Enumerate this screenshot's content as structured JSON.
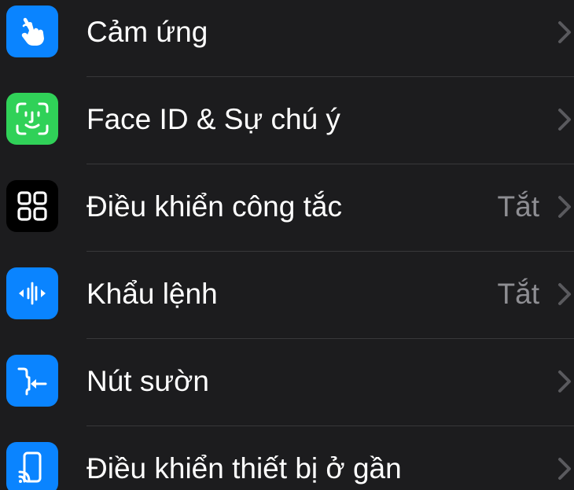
{
  "settings": {
    "rows": [
      {
        "label": "Cảm ứng",
        "value": "",
        "icon": "touch-hand-icon",
        "icon_bg": "#0a84ff"
      },
      {
        "label": "Face ID & Sự chú ý",
        "value": "",
        "icon": "face-id-icon",
        "icon_bg": "#30d158"
      },
      {
        "label": "Điều khiển công tắc",
        "value": "Tắt",
        "icon": "switch-control-grid-icon",
        "icon_bg": "#000000"
      },
      {
        "label": "Khẩu lệnh",
        "value": "Tắt",
        "icon": "voice-control-waveform-icon",
        "icon_bg": "#0a84ff"
      },
      {
        "label": "Nút sườn",
        "value": "",
        "icon": "side-button-icon",
        "icon_bg": "#0a84ff"
      },
      {
        "label": "Điều khiển thiết bị ở gần",
        "value": "",
        "icon": "nearby-device-control-icon",
        "icon_bg": "#0a84ff"
      }
    ],
    "colors": {
      "background": "#1c1c1e",
      "label": "#ffffff",
      "value": "#8e8e93",
      "chevron": "#5a5a5e",
      "separator": "#38383a"
    }
  }
}
